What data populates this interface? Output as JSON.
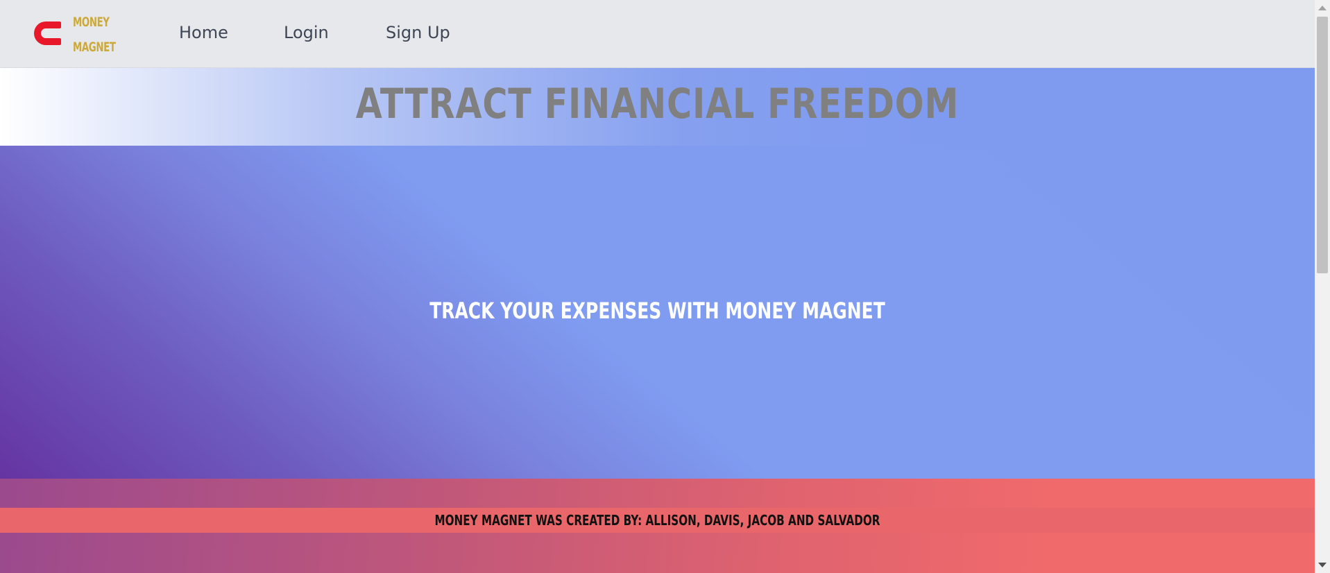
{
  "brand": {
    "line1": "MONEY",
    "line2": "MAGNET",
    "color": "#cba93a",
    "logo_icon": "magnet-icon",
    "logo_color": "#e8182a"
  },
  "nav": {
    "home": "Home",
    "login": "Login",
    "signup": "Sign Up"
  },
  "header": {
    "title": "ATTRACT FINANCIAL FREEDOM"
  },
  "hero": {
    "text": "TRACK YOUR EXPENSES WITH MONEY MAGNET"
  },
  "footer": {
    "credits": "MONEY MAGNET WAS CREATED BY: ALLISON, DAVIS, JACOB AND SALVADOR"
  },
  "colors": {
    "accent_blue": "#7f9bf0",
    "hero_purple": "#6534a1",
    "footer_red": "#f06a6b",
    "navbar_bg": "#e7e8ec"
  }
}
